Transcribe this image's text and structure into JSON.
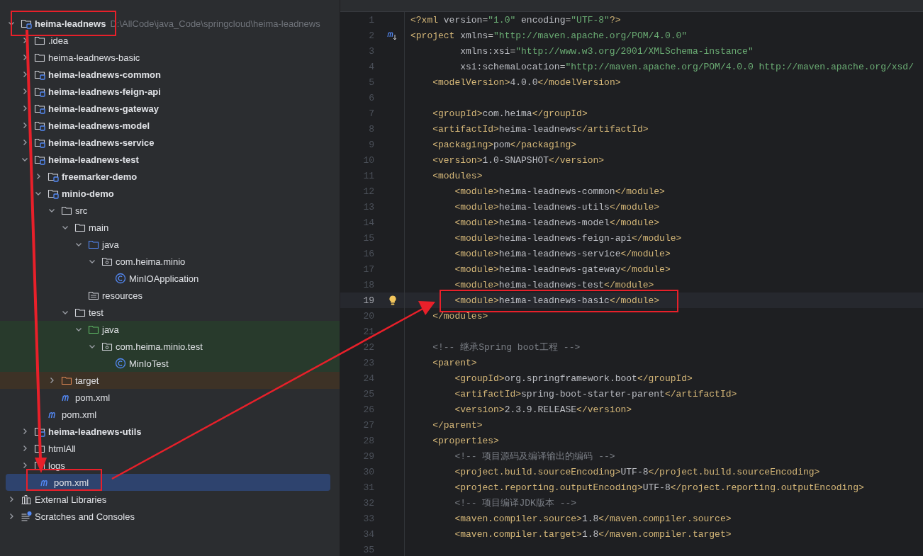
{
  "project_tree": [
    {
      "name": "heima-leadnews",
      "kind": "module",
      "path": "D:\\AllCode\\java_Code\\springcloud\\heima-leadnews",
      "expanded": true,
      "selected": false,
      "children": [
        {
          "name": ".idea",
          "kind": "folder",
          "expanded": false,
          "selected": false
        },
        {
          "name": "heima-leadnews-basic",
          "kind": "folder",
          "expanded": false,
          "selected": false
        },
        {
          "name": "heima-leadnews-common",
          "kind": "module",
          "expanded": false,
          "selected": false
        },
        {
          "name": "heima-leadnews-feign-api",
          "kind": "module",
          "expanded": false,
          "selected": false
        },
        {
          "name": "heima-leadnews-gateway",
          "kind": "module",
          "expanded": false,
          "selected": false
        },
        {
          "name": "heima-leadnews-model",
          "kind": "module",
          "expanded": false,
          "selected": false
        },
        {
          "name": "heima-leadnews-service",
          "kind": "module",
          "expanded": false,
          "selected": false
        },
        {
          "name": "heima-leadnews-test",
          "kind": "module",
          "expanded": true,
          "selected": false,
          "children": [
            {
              "name": "freemarker-demo",
              "kind": "module",
              "expanded": false,
              "selected": false
            },
            {
              "name": "minio-demo",
              "kind": "module",
              "expanded": true,
              "selected": false,
              "children": [
                {
                  "name": "src",
                  "kind": "folder",
                  "expanded": true,
                  "selected": false,
                  "children": [
                    {
                      "name": "main",
                      "kind": "folder",
                      "expanded": true,
                      "selected": false,
                      "children": [
                        {
                          "name": "java",
                          "kind": "source-folder",
                          "expanded": true,
                          "selected": false,
                          "children": [
                            {
                              "name": "com.heima.minio",
                              "kind": "package",
                              "expanded": true,
                              "selected": false,
                              "children": [
                                {
                                  "name": "MinIOApplication",
                                  "kind": "class",
                                  "selected": false
                                }
                              ]
                            }
                          ]
                        },
                        {
                          "name": "resources",
                          "kind": "resources-folder",
                          "selected": false
                        }
                      ]
                    },
                    {
                      "name": "test",
                      "kind": "folder",
                      "expanded": true,
                      "selected": false,
                      "children": [
                        {
                          "name": "java",
                          "kind": "test-folder",
                          "test_scope": true,
                          "expanded": true,
                          "selected": false,
                          "children": [
                            {
                              "name": "com.heima.minio.test",
                              "kind": "package",
                              "test_scope": true,
                              "expanded": true,
                              "selected": false,
                              "children": [
                                {
                                  "name": "MinIoTest",
                                  "kind": "class",
                                  "test_scope": true,
                                  "selected": false
                                }
                              ]
                            }
                          ]
                        }
                      ]
                    }
                  ]
                },
                {
                  "name": "target",
                  "kind": "excluded-folder",
                  "excluded": true,
                  "expanded": false,
                  "selected": false
                },
                {
                  "name": "pom.xml",
                  "kind": "maven",
                  "selected": false
                }
              ]
            },
            {
              "name": "pom.xml",
              "kind": "maven",
              "selected": false
            }
          ]
        },
        {
          "name": "heima-leadnews-utils",
          "kind": "module",
          "expanded": false,
          "selected": false
        },
        {
          "name": "htmlAll",
          "kind": "folder",
          "expanded": false,
          "selected": false
        },
        {
          "name": "logs",
          "kind": "folder",
          "expanded": false,
          "selected": false
        },
        {
          "name": "pom.xml",
          "kind": "maven",
          "selected": true
        }
      ]
    },
    {
      "name": "External Libraries",
      "kind": "libraries",
      "expanded": false,
      "selected": false
    },
    {
      "name": "Scratches and Consoles",
      "kind": "scratches",
      "expanded": false,
      "selected": false
    }
  ],
  "editor": {
    "lines": [
      {
        "n": "1",
        "code": "<?xml version=\"1.0\" encoding=\"UTF-8\"?>",
        "current": false
      },
      {
        "n": "2",
        "code": "<project xmlns=\"http://maven.apache.org/POM/4.0.0\"",
        "current": false,
        "kind": "maven-marker"
      },
      {
        "n": "3",
        "code": "         xmlns:xsi=\"http://www.w3.org/2001/XMLSchema-instance\"",
        "current": false
      },
      {
        "n": "4",
        "code": "         xsi:schemaLocation=\"http://maven.apache.org/POM/4.0.0 http://maven.apache.org/xsd/",
        "current": false
      },
      {
        "n": "5",
        "code": "    <modelVersion>4.0.0</modelVersion>",
        "current": false
      },
      {
        "n": "6",
        "current": false
      },
      {
        "n": "7",
        "code": "    <groupId>com.heima</groupId>",
        "current": false
      },
      {
        "n": "8",
        "code": "    <artifactId>heima-leadnews</artifactId>",
        "current": false
      },
      {
        "n": "9",
        "code": "    <packaging>pom</packaging>",
        "current": false
      },
      {
        "n": "10",
        "code": "    <version>1.0-SNAPSHOT</version>",
        "current": false
      },
      {
        "n": "11",
        "code": "    <modules>",
        "current": false
      },
      {
        "n": "12",
        "code": "        <module>heima-leadnews-common</module>",
        "current": false
      },
      {
        "n": "13",
        "code": "        <module>heima-leadnews-utils</module>",
        "current": false
      },
      {
        "n": "14",
        "code": "        <module>heima-leadnews-model</module>",
        "current": false
      },
      {
        "n": "15",
        "code": "        <module>heima-leadnews-feign-api</module>",
        "current": false
      },
      {
        "n": "16",
        "code": "        <module>heima-leadnews-service</module>",
        "current": false
      },
      {
        "n": "17",
        "code": "        <module>heima-leadnews-gateway</module>",
        "current": false
      },
      {
        "n": "18",
        "code": "        <module>heima-leadnews-test</module>",
        "current": false
      },
      {
        "n": "19",
        "code": "        <module>heima-leadnews-basic</module>",
        "current": true,
        "kind": "intention"
      },
      {
        "n": "20",
        "code": "    </modules>",
        "current": false
      },
      {
        "n": "21",
        "current": false
      },
      {
        "n": "22",
        "code": "    <!-- 继承Spring boot工程 -->",
        "current": false
      },
      {
        "n": "23",
        "code": "    <parent>",
        "current": false
      },
      {
        "n": "24",
        "code": "        <groupId>org.springframework.boot</groupId>",
        "current": false
      },
      {
        "n": "25",
        "code": "        <artifactId>spring-boot-starter-parent</artifactId>",
        "current": false
      },
      {
        "n": "26",
        "code": "        <version>2.3.9.RELEASE</version>",
        "current": false
      },
      {
        "n": "27",
        "code": "    </parent>",
        "current": false
      },
      {
        "n": "28",
        "code": "    <properties>",
        "current": false
      },
      {
        "n": "29",
        "code": "        <!-- 项目源码及编译输出的编码 -->",
        "current": false
      },
      {
        "n": "30",
        "code": "        <project.build.sourceEncoding>UTF-8</project.build.sourceEncoding>",
        "current": false
      },
      {
        "n": "31",
        "code": "        <project.reporting.outputEncoding>UTF-8</project.reporting.outputEncoding>",
        "current": false
      },
      {
        "n": "32",
        "code": "        <!-- 项目编译JDK版本 -->",
        "current": false
      },
      {
        "n": "33",
        "code": "        <maven.compiler.source>1.8</maven.compiler.source>",
        "current": false
      },
      {
        "n": "34",
        "code": "        <maven.compiler.target>1.8</maven.compiler.target>",
        "current": false
      },
      {
        "n": "35",
        "current": false
      }
    ]
  }
}
